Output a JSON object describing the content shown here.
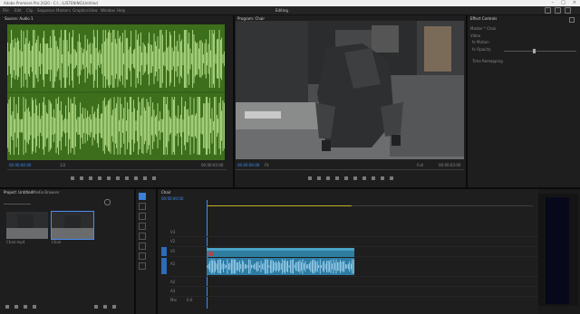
{
  "window": {
    "title": "Adobe Premiere Pro 2020 - C:\\...\\LISTENING\\Untitled"
  },
  "menu": {
    "items": [
      "File",
      "Edit",
      "Clip",
      "Sequence",
      "Markers",
      "Graphics",
      "View",
      "Window",
      "Help"
    ],
    "workspace_title": "Editing"
  },
  "source_monitor": {
    "tab_label": "Source: Audio 1",
    "timecode_in": "00:00:00:00",
    "zoom": "1/2",
    "timecode_out": "00:00:03:00"
  },
  "program_monitor": {
    "tab_label": "Program: Chair",
    "timecode_in": "00:00:00:00",
    "fit": "Fit",
    "zoom": "Full",
    "timecode_out": "00:00:03:00"
  },
  "effect_controls": {
    "tab_label": "Effect Controls",
    "lines": [
      "Master * Chair",
      "Video",
      "fx Motion",
      "fx Opacity",
      "Time Remapping"
    ]
  },
  "project_panel": {
    "tabs": [
      "Project: Untitled",
      "Media Browser"
    ],
    "items": [
      {
        "label": "Chair.mp4"
      },
      {
        "label": "Chair"
      }
    ]
  },
  "timeline": {
    "tab_label": "Chair",
    "timecode": "00:00:00:00",
    "tracks": [
      "V3",
      "V2",
      "V1",
      "A1",
      "A2",
      "A3",
      "Mix"
    ],
    "master_value": "0.0"
  },
  "colors": {
    "accent": "#3a8ef6",
    "waveform_bg": "#3c6e1b",
    "waveform_fg": "#c8f29a",
    "clip_video": "#2f7d9f",
    "clip_audio": "#2c7ca5"
  }
}
